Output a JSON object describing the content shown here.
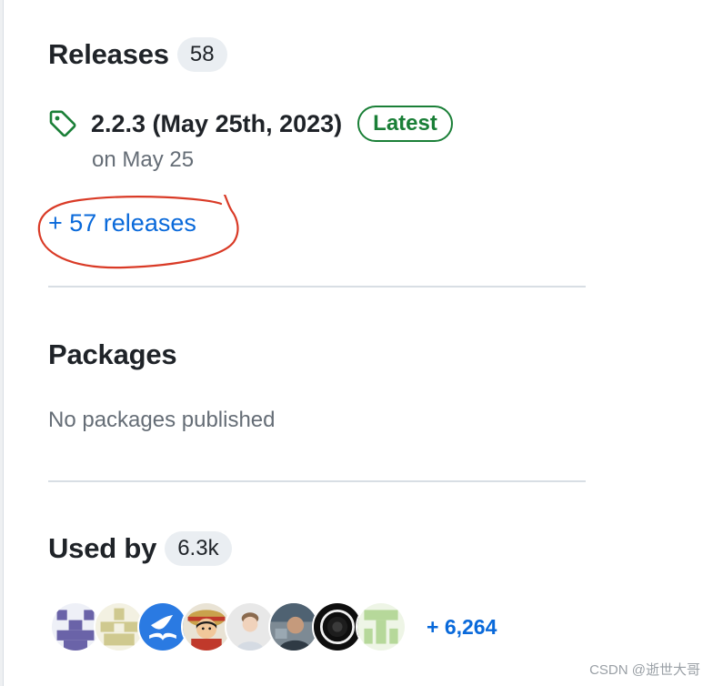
{
  "releases": {
    "heading": "Releases",
    "count": "58",
    "latest": {
      "title": "2.2.3 (May 25th, 2023)",
      "badge": "Latest",
      "date": "on May 25"
    },
    "more_link": "+ 57 releases"
  },
  "packages": {
    "heading": "Packages",
    "empty_text": "No packages published"
  },
  "used_by": {
    "heading": "Used by",
    "count": "6.3k",
    "avatars": [
      {
        "name": "avatar-identicon-purple",
        "icon": "identicon"
      },
      {
        "name": "avatar-identicon-olive",
        "icon": "identicon"
      },
      {
        "name": "avatar-bird-logo",
        "icon": "bird-logo-icon"
      },
      {
        "name": "avatar-cartoon-character",
        "icon": "cartoon-icon"
      },
      {
        "name": "avatar-person-3d",
        "icon": "person-icon"
      },
      {
        "name": "avatar-person-photo",
        "icon": "person-photo-icon"
      },
      {
        "name": "avatar-dark-lens",
        "icon": "lens-icon"
      },
      {
        "name": "avatar-identicon-green",
        "icon": "identicon"
      }
    ],
    "more_count": "+ 6,264"
  },
  "watermark": "CSDN @逝世大哥",
  "colors": {
    "link": "#0969da",
    "badge_green": "#1a7f37",
    "muted": "#656d76",
    "annotation_red": "#d93a26"
  }
}
